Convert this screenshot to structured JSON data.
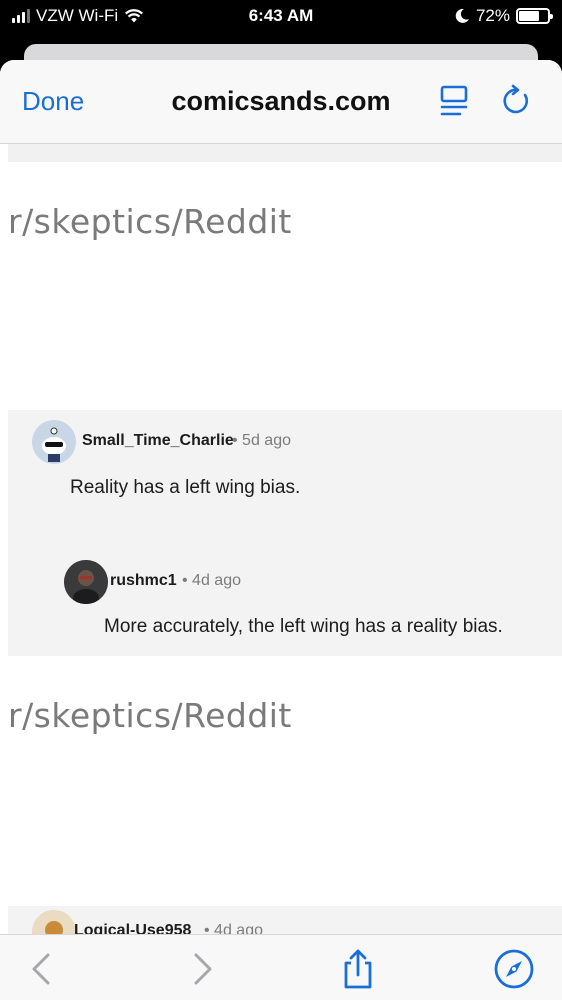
{
  "status_bar": {
    "carrier": "VZW Wi-Fi",
    "time": "6:43 AM",
    "battery": "72%",
    "battery_level": 0.72
  },
  "browser": {
    "done_label": "Done",
    "site_title": "comicsands.com",
    "accent_color": "#1a6fd6"
  },
  "content": {
    "source_label_1": "r/skeptics/Reddit",
    "source_label_2": "r/skeptics/Reddit",
    "comments": [
      {
        "username": "Small_Time_Charlie",
        "age": "• 5d ago",
        "text": "Reality has a left wing bias."
      },
      {
        "username": "rushmc1",
        "age": "• 4d ago",
        "text": "More accurately, the left wing has a reality bias."
      }
    ],
    "next_comment": {
      "username": "Logical-Use958",
      "age": "• 4d ago"
    }
  },
  "toolbar": {
    "icons": [
      "back-icon",
      "forward-icon",
      "share-icon",
      "compass-icon"
    ]
  }
}
